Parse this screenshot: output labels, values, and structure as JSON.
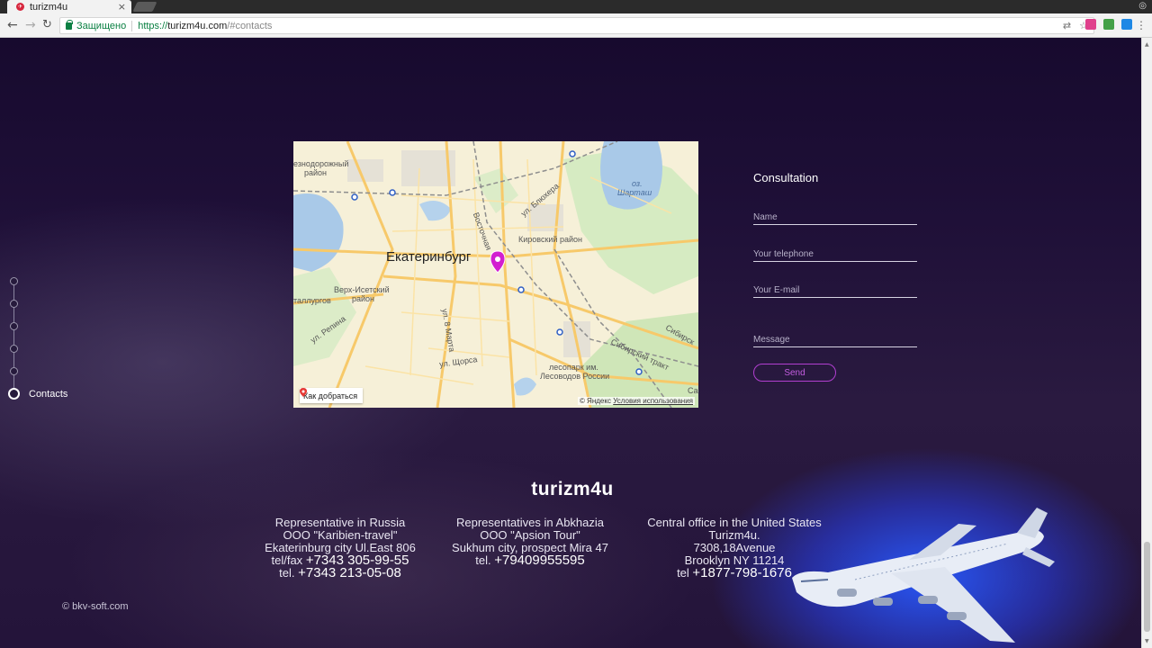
{
  "browser": {
    "tab_title": "turizm4u",
    "tab_close": "×",
    "secure_label": "Защищено",
    "url_scheme": "https://",
    "url_host": "turizm4u.com",
    "url_hash": "/#contacts"
  },
  "sidenav": {
    "active_label": "Contacts"
  },
  "map": {
    "city": "Екатеринбург",
    "labels": {
      "railway": "езнодорожный",
      "railway2": "район",
      "kirov": "Кировский район",
      "verkh": "Верх-Исетский",
      "verkh2": "район",
      "lake": "оз.",
      "lake2": "Шарташ",
      "elizhera": "ул. Блюхера",
      "vostochnaya": "Восточная",
      "repina": "ул. Репина",
      "malyshev": "ул. 8 Марта",
      "shchorsa": "ул. Щорса",
      "sibirsky": "Сибирский тракт",
      "lesopark": "лесопарк им.",
      "lesopark2": "Лесоводов России",
      "metallurgov": "таллургов",
      "sibirsk_right": "Сибирск",
      "sa": "Са"
    },
    "route_label": "Как добраться",
    "copyright": "© Яндекс",
    "terms": "Условия использования"
  },
  "form": {
    "title": "Consultation",
    "name_placeholder": "Name",
    "phone_placeholder": "Your telephone",
    "email_placeholder": "Your E-mail",
    "message_placeholder": "Message",
    "send_label": "Send"
  },
  "footer": {
    "brand": "turizm4u",
    "russia": {
      "line1": "Representative in Russia",
      "line2": "OOO \"Karibien-travel\"",
      "line3": "Ekaterinburg city Ul.East 806",
      "tel1_prefix": "tel/fax",
      "tel1": "+7343 305-99-55",
      "tel2_prefix": "tel.",
      "tel2": "+7343 213-05-08"
    },
    "abkhazia": {
      "line1": "Representatives in Abkhazia",
      "line2": "OOO \"Apsion Tour\"",
      "line3": "Sukhum city, prospect Mira 47",
      "tel_prefix": "tel.",
      "tel": "+79409955595"
    },
    "usa": {
      "line1": "Central office in the United States",
      "line2": "Turizm4u.",
      "line3": "7308,18Avenue",
      "line4": "Brooklyn NY 11214",
      "tel_prefix": "tel",
      "tel": "+1877-798-1676"
    },
    "copyright": "© bkv-soft.com"
  },
  "colors": {
    "accent": "#b13fd0",
    "page_bg": "#1a0c33",
    "glow": "#2850ff"
  }
}
